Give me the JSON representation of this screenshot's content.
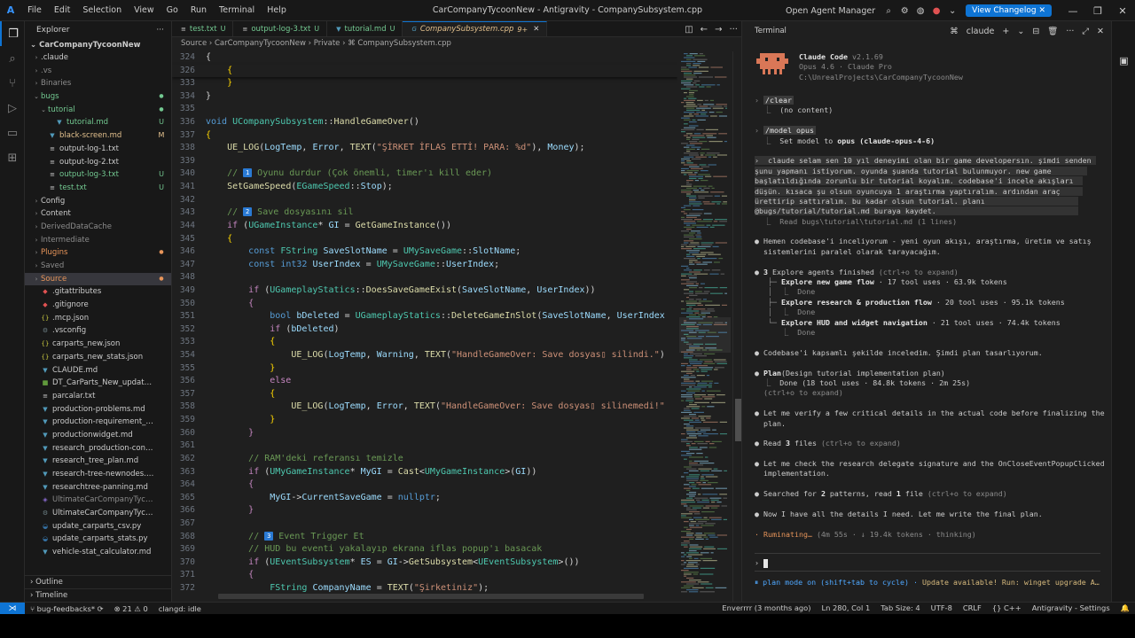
{
  "window": {
    "title": "CarCompanyTycoonNew - Antigravity - CompanySubsystem.cpp",
    "menu": [
      "File",
      "Edit",
      "Selection",
      "View",
      "Go",
      "Run",
      "Terminal",
      "Help"
    ],
    "agent_manager": "Open Agent Manager",
    "changelog_button": "View Changelog"
  },
  "explorer": {
    "header": "Explorer",
    "project": "CarCompanyTycoonNew",
    "items": [
      {
        "name": ".claude",
        "arrow": "›",
        "depth": 1,
        "type": "folder",
        "color": "#cccccc"
      },
      {
        "name": ".vs",
        "arrow": "›",
        "depth": 1,
        "type": "folder",
        "color": "#8c8c8c"
      },
      {
        "name": "Binaries",
        "arrow": "›",
        "depth": 1,
        "type": "folder",
        "color": "#8c8c8c"
      },
      {
        "name": "bugs",
        "arrow": "⌄",
        "depth": 1,
        "type": "folder",
        "color": "#73c991",
        "dot": true
      },
      {
        "name": "tutorial",
        "arrow": "⌄",
        "depth": 2,
        "type": "folder",
        "color": "#73c991",
        "dot": true
      },
      {
        "name": "tutorial.md",
        "arrow": "",
        "depth": 3,
        "type": "md",
        "color": "#73c991",
        "badge": "U"
      },
      {
        "name": "black-screen.md",
        "arrow": "",
        "depth": 2,
        "type": "md",
        "color": "#e2c08d",
        "badge": "M"
      },
      {
        "name": "output-log-1.txt",
        "arrow": "",
        "depth": 2,
        "type": "txt",
        "color": "#cccccc"
      },
      {
        "name": "output-log-2.txt",
        "arrow": "",
        "depth": 2,
        "type": "txt",
        "color": "#cccccc"
      },
      {
        "name": "output-log-3.txt",
        "arrow": "",
        "depth": 2,
        "type": "txt",
        "color": "#73c991",
        "badge": "U"
      },
      {
        "name": "test.txt",
        "arrow": "",
        "depth": 2,
        "type": "txt",
        "color": "#73c991",
        "badge": "U"
      },
      {
        "name": "Config",
        "arrow": "›",
        "depth": 1,
        "type": "folder",
        "color": "#cccccc"
      },
      {
        "name": "Content",
        "arrow": "›",
        "depth": 1,
        "type": "folder",
        "color": "#cccccc"
      },
      {
        "name": "DerivedDataCache",
        "arrow": "›",
        "depth": 1,
        "type": "folder",
        "color": "#8c8c8c"
      },
      {
        "name": "Intermediate",
        "arrow": "›",
        "depth": 1,
        "type": "folder",
        "color": "#8c8c8c"
      },
      {
        "name": "Plugins",
        "arrow": "›",
        "depth": 1,
        "type": "folder",
        "color": "#e8955a",
        "dot": true
      },
      {
        "name": "Saved",
        "arrow": "›",
        "depth": 1,
        "type": "folder",
        "color": "#8c8c8c"
      },
      {
        "name": "Source",
        "arrow": "›",
        "depth": 1,
        "type": "folder",
        "color": "#e8955a",
        "dot": true,
        "selected": true
      },
      {
        "name": ".gitattributes",
        "arrow": "",
        "depth": 1,
        "type": "git",
        "color": "#cccccc"
      },
      {
        "name": ".gitignore",
        "arrow": "",
        "depth": 1,
        "type": "git",
        "color": "#cccccc"
      },
      {
        "name": ".mcp.json",
        "arrow": "",
        "depth": 1,
        "type": "json",
        "color": "#cccccc"
      },
      {
        "name": ".vsconfig",
        "arrow": "",
        "depth": 1,
        "type": "cfg",
        "color": "#cccccc"
      },
      {
        "name": "carparts_new.json",
        "arrow": "",
        "depth": 1,
        "type": "json",
        "color": "#cccccc"
      },
      {
        "name": "carparts_new_stats.json",
        "arrow": "",
        "depth": 1,
        "type": "json",
        "color": "#cccccc"
      },
      {
        "name": "CLAUDE.md",
        "arrow": "",
        "depth": 1,
        "type": "md",
        "color": "#cccccc"
      },
      {
        "name": "DT_CarParts_New_updated.csv",
        "arrow": "",
        "depth": 1,
        "type": "csv",
        "color": "#cccccc"
      },
      {
        "name": "parcalar.txt",
        "arrow": "",
        "depth": 1,
        "type": "txt",
        "color": "#cccccc"
      },
      {
        "name": "production-problems.md",
        "arrow": "",
        "depth": 1,
        "type": "md",
        "color": "#cccccc"
      },
      {
        "name": "production-requirement_conflict...",
        "arrow": "",
        "depth": 1,
        "type": "md",
        "color": "#cccccc"
      },
      {
        "name": "productionwidget.md",
        "arrow": "",
        "depth": 1,
        "type": "md",
        "color": "#cccccc"
      },
      {
        "name": "research_production-conflicts.md",
        "arrow": "",
        "depth": 1,
        "type": "md",
        "color": "#cccccc"
      },
      {
        "name": "research_tree_plan.md",
        "arrow": "",
        "depth": 1,
        "type": "md",
        "color": "#cccccc"
      },
      {
        "name": "research-tree-newnodes.md",
        "arrow": "",
        "depth": 1,
        "type": "md",
        "color": "#cccccc"
      },
      {
        "name": "researchtree-panning.md",
        "arrow": "",
        "depth": 1,
        "type": "md",
        "color": "#cccccc"
      },
      {
        "name": "UltimateCarCompanyTycoon.sln",
        "arrow": "",
        "depth": 1,
        "type": "sln",
        "color": "#8c8c8c"
      },
      {
        "name": "UltimateCarCompanyTycoon.upr...",
        "arrow": "",
        "depth": 1,
        "type": "cfg",
        "color": "#cccccc"
      },
      {
        "name": "update_carparts_csv.py",
        "arrow": "",
        "depth": 1,
        "type": "py",
        "color": "#cccccc"
      },
      {
        "name": "update_carparts_stats.py",
        "arrow": "",
        "depth": 1,
        "type": "py",
        "color": "#cccccc"
      },
      {
        "name": "vehicle-stat_calculator.md",
        "arrow": "",
        "depth": 1,
        "type": "md",
        "color": "#cccccc"
      }
    ],
    "outline": "Outline",
    "timeline": "Timeline"
  },
  "tabs": [
    {
      "label": "test.txt",
      "status": "U",
      "active": false
    },
    {
      "label": "output-log-3.txt",
      "status": "U",
      "active": false
    },
    {
      "label": "tutorial.md",
      "status": "U",
      "active": false
    },
    {
      "label": "CompanySubsystem.cpp",
      "status": "9+",
      "active": true
    }
  ],
  "breadcrumb": "Source › CarCompanyTycoonNew › Private › ⌘ CompanySubsystem.cpp",
  "code": {
    "lines": [
      {
        "n": "324",
        "html": "{",
        "sticky": true
      },
      {
        "n": "326",
        "html": "    <span class='p'>{</span>",
        "sticky": true
      },
      {
        "n": "333",
        "html": "    <span class='p'>}</span>"
      },
      {
        "n": "334",
        "html": "}"
      },
      {
        "n": "335",
        "html": ""
      },
      {
        "n": "336",
        "html": "<span class='k'>void</span> <span class='t'>UCompanySubsystem</span>::<span class='f'>HandleGameOver</span>()"
      },
      {
        "n": "337",
        "html": "<span class='p'>{</span>"
      },
      {
        "n": "338",
        "html": "    <span class='f'>UE_LOG</span>(<span class='v'>LogTemp</span>, <span class='v'>Error</span>, <span class='f'>TEXT</span>(<span class='s'>\"ŞİRKET İFLAS ETTİ! PARA: %d\"</span>), <span class='v'>Money</span>);"
      },
      {
        "n": "339",
        "html": ""
      },
      {
        "n": "340",
        "html": "    <span class='c'>// </span><span class='em'>1</span><span class='c'> Oyunu durdur (Çok önemli, timer'ı kill eder)</span>"
      },
      {
        "n": "341",
        "html": "    <span class='f'>SetGameSpeed</span>(<span class='t'>EGameSpeed</span>::<span class='v'>Stop</span>);"
      },
      {
        "n": "342",
        "html": ""
      },
      {
        "n": "343",
        "html": "    <span class='c'>// </span><span class='em'>2</span><span class='c'> Save dosyasını sil</span>"
      },
      {
        "n": "344",
        "html": "    <span class='m'>if</span> (<span class='t'>UGameInstance</span>* <span class='v'>GI</span> = <span class='f'>GetGameInstance</span>())"
      },
      {
        "n": "345",
        "html": "    <span class='p'>{</span>"
      },
      {
        "n": "346",
        "html": "        <span class='k'>const</span> <span class='t'>FString</span> <span class='v'>SaveSlotName</span> = <span class='t'>UMySaveGame</span>::<span class='v'>SlotName</span>;"
      },
      {
        "n": "347",
        "html": "        <span class='k'>const</span> <span class='k'>int32</span> <span class='v'>UserIndex</span> = <span class='t'>UMySaveGame</span>::<span class='v'>UserIndex</span>;"
      },
      {
        "n": "348",
        "html": ""
      },
      {
        "n": "349",
        "html": "        <span class='m'>if</span> (<span class='t'>UGameplayStatics</span>::<span class='f'>DoesSaveGameExist</span>(<span class='v'>SaveSlotName</span>, <span class='v'>UserIndex</span>))"
      },
      {
        "n": "350",
        "html": "        <span class='m'>{</span>"
      },
      {
        "n": "351",
        "html": "            <span class='k'>bool</span> <span class='v'>bDeleted</span> = <span class='t'>UGameplayStatics</span>::<span class='f'>DeleteGameInSlot</span>(<span class='v'>SaveSlotName</span>, <span class='v'>UserIndex</span>"
      },
      {
        "n": "352",
        "html": "            <span class='m'>if</span> (<span class='v'>bDeleted</span>)"
      },
      {
        "n": "353",
        "html": "            <span class='p'>{</span>"
      },
      {
        "n": "354",
        "html": "                <span class='f'>UE_LOG</span>(<span class='v'>LogTemp</span>, <span class='v'>Warning</span>, <span class='f'>TEXT</span>(<span class='s'>\"HandleGameOver: Save dosyas▯ silindi.\"</span>)"
      },
      {
        "n": "355",
        "html": "            <span class='p'>}</span>"
      },
      {
        "n": "356",
        "html": "            <span class='m'>else</span>"
      },
      {
        "n": "357",
        "html": "            <span class='p'>{</span>"
      },
      {
        "n": "358",
        "html": "                <span class='f'>UE_LOG</span>(<span class='v'>LogTemp</span>, <span class='v'>Error</span>, <span class='f'>TEXT</span>(<span class='s'>\"HandleGameOver: Save dosyas▯ silinemedi!\"</span>"
      },
      {
        "n": "359",
        "html": "            <span class='p'>}</span>"
      },
      {
        "n": "360",
        "html": "        <span class='m'>}</span>"
      },
      {
        "n": "361",
        "html": ""
      },
      {
        "n": "362",
        "html": "        <span class='c'>// RAM'deki referansı temizle</span>"
      },
      {
        "n": "363",
        "html": "        <span class='m'>if</span> (<span class='t'>UMyGameInstance</span>* <span class='v'>MyGI</span> = <span class='f'>Cast</span>&lt;<span class='t'>UMyGameInstance</span>&gt;(<span class='v'>GI</span>))"
      },
      {
        "n": "364",
        "html": "        <span class='m'>{</span>"
      },
      {
        "n": "365",
        "html": "            <span class='v'>MyGI</span>-&gt;<span class='v'>CurrentSaveGame</span> = <span class='k'>nullptr</span>;"
      },
      {
        "n": "366",
        "html": "        <span class='m'>}</span>"
      },
      {
        "n": "367",
        "html": ""
      },
      {
        "n": "368",
        "html": "        <span class='c'>// </span><span class='em'>3</span><span class='c'> Event Trigger Et</span>"
      },
      {
        "n": "369",
        "html": "        <span class='c'>// HUD bu eventi yakalayıp ekrana iflas popup'ı basacak</span>"
      },
      {
        "n": "370",
        "html": "        <span class='m'>if</span> (<span class='t'>UEventSubsystem</span>* <span class='v'>ES</span> = <span class='v'>GI</span>-&gt;<span class='f'>GetSubsystem</span>&lt;<span class='t'>UEventSubsystem</span>&gt;())"
      },
      {
        "n": "371",
        "html": "        <span class='m'>{</span>"
      },
      {
        "n": "372",
        "html": "            <span class='t'>FString</span> <span class='v'>CompanyName</span> = <span class='f'>TEXT</span>(<span class='s'>\"Şirketiniz\"</span>);"
      }
    ]
  },
  "panel": {
    "header": "Terminal",
    "terminal_name": "claude",
    "claude_title": "Claude Code",
    "claude_version": "v2.1.69",
    "model_line": "Opus 4.6 · Claude Pro",
    "path": "C:\\UnrealProjects\\CarCompanyTycoonNew",
    "prompt_symbol": "›",
    "lines": [
      {
        "html": "<span class='dim'>›</span> <span class='cmdbox'>/clear</span>"
      },
      {
        "html": "  <span class='dim'>⎿</span>  (no content)"
      },
      {
        "html": ""
      },
      {
        "html": "<span class='dim'>›</span> <span class='cmdbox'>/model opus</span>"
      },
      {
        "html": "  <span class='dim'>⎿</span>  Set model to <span class='bold'>opus (claude-opus-4-6)</span>"
      },
      {
        "html": ""
      },
      {
        "html": "<span class='userbox'>›  claude selam sen 10 yıl deneyimi olan bir game developersın. şimdi senden </span>",
        "box": true
      },
      {
        "html": "<span class='userbox'>şunu yapmanı istiyorum. oyunda şuanda tutorial bulunmuyor. new game        </span>",
        "box": true
      },
      {
        "html": "<span class='userbox'>başlatıldığında zorunlu bir tutorial koyalım. codebase'i incele akışları  </span>",
        "box": true
      },
      {
        "html": "<span class='userbox'>düşün. kısaca şu olsun oyuncuya 1 araştırma yaptıralım. ardından araç     </span>",
        "box": true
      },
      {
        "html": "<span class='userbox'>ürettirip sattıralım. bu kadar olsun tutorial. planı                     </span>",
        "box": true
      },
      {
        "html": "<span class='userbox'>@bugs/tutorial/tutorial.md buraya kaydet.                                </span>",
        "box": true
      },
      {
        "html": "  <span class='dim'>⎿  Read bugs\\tutorial\\tutorial.md (1 lines)</span>"
      },
      {
        "html": ""
      },
      {
        "html": "● Hemen codebase'i inceliyorum - yeni oyun akışı, araştırma, üretim ve satış"
      },
      {
        "html": "  sistemlerini paralel olarak tarayacağım."
      },
      {
        "html": ""
      },
      {
        "html": "● <span class='bold'>3</span> Explore agents finished <span class='dim'>(ctrl+o to expand)</span>"
      },
      {
        "html": "   <span class='dim'>├─</span> <span class='bold'>Explore new game flow</span> · 17 tool uses · 63.9k tokens"
      },
      {
        "html": "   <span class='dim'>│  ⎿  Done</span>"
      },
      {
        "html": "   <span class='dim'>├─</span> <span class='bold'>Explore research &amp; production flow</span> · 20 tool uses · 95.1k tokens"
      },
      {
        "html": "   <span class='dim'>│  ⎿  Done</span>"
      },
      {
        "html": "   <span class='dim'>└─</span> <span class='bold'>Explore HUD and widget navigation</span> · 21 tool uses · 74.4k tokens"
      },
      {
        "html": "      <span class='dim'>⎿  Done</span>"
      },
      {
        "html": ""
      },
      {
        "html": "● Codebase'i kapsamlı şekilde inceledim. Şimdi plan tasarlıyorum."
      },
      {
        "html": ""
      },
      {
        "html": "● <span class='bold'>Plan</span>(Design tutorial implementation plan)"
      },
      {
        "html": "  <span class='dim'>⎿</span>  Done (18 tool uses · 84.8k tokens · 2m 25s)"
      },
      {
        "html": "  <span class='dim'>(ctrl+o to expand)</span>"
      },
      {
        "html": ""
      },
      {
        "html": "● Let me verify a few critical details in the actual code before finalizing the"
      },
      {
        "html": "  plan."
      },
      {
        "html": ""
      },
      {
        "html": "● Read <span class='bold'>3</span> files <span class='dim'>(ctrl+o to expand)</span>"
      },
      {
        "html": ""
      },
      {
        "html": "● Let me check the research delegate signature and the OnCloseEventPopupClicked"
      },
      {
        "html": "  implementation."
      },
      {
        "html": ""
      },
      {
        "html": "● Searched for <span class='bold'>2</span> patterns, read <span class='bold'>1</span> file <span class='dim'>(ctrl+o to expand)</span>"
      },
      {
        "html": ""
      },
      {
        "html": "● Now I have all the details I need. Let me write the final plan."
      },
      {
        "html": ""
      },
      {
        "html": "<span class='orange'>· Ruminating…</span> <span class='dim'>(4m 55s · ↓ 19.4k tokens · thinking)</span>"
      }
    ],
    "input_prompt": "› ",
    "footer_left": "⏸ plan mode on (shift+tab to cycle) · ",
    "footer_right": "Update available! Run: winget upgrade A…"
  },
  "statusbar": {
    "remote": "⋊",
    "branch": "bug-feedbacks*",
    "errors": "⊗ 21 ⚠ 0",
    "clangd": "clangd: idle",
    "blame": "Enverrrr (3 months ago)",
    "position": "Ln 280, Col 1",
    "tab_size": "Tab Size: 4",
    "encoding": "UTF-8",
    "eol": "CRLF",
    "language": "{} C++",
    "settings": "Antigravity - Settings"
  },
  "colors": {
    "accent": "#0e74d4",
    "added": "#73c991",
    "modified": "#e2c08d",
    "claude_logo": "#d97757"
  }
}
